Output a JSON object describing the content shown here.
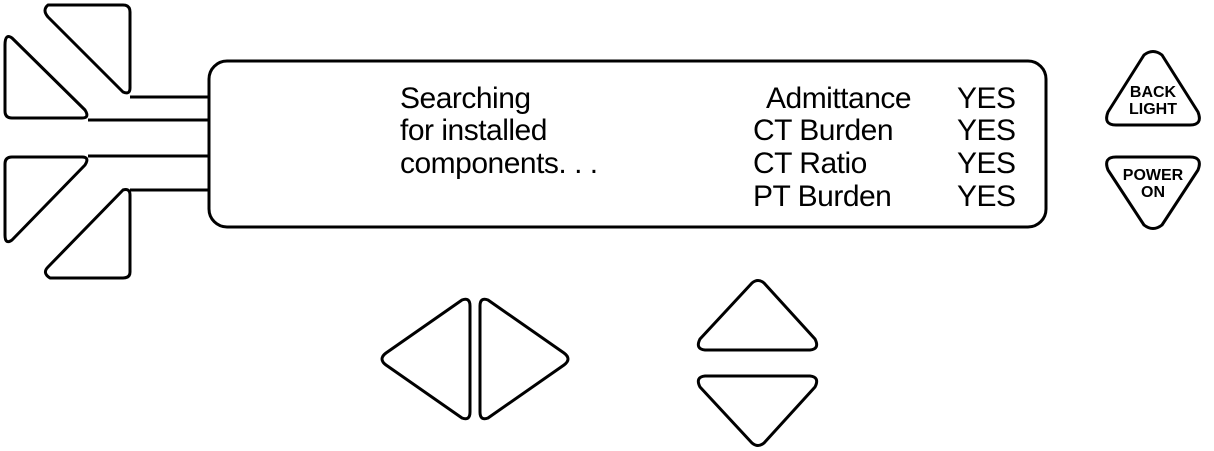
{
  "display": {
    "message_lines": [
      "Searching",
      "for installed",
      "components. . ."
    ],
    "components": [
      {
        "name": "Admittance",
        "status": "YES"
      },
      {
        "name": "CT Burden",
        "status": "YES"
      },
      {
        "name": "CT Ratio",
        "status": "YES"
      },
      {
        "name": "PT Burden",
        "status": "YES"
      }
    ]
  },
  "buttons": {
    "backlight": {
      "line1": "BACK",
      "line2": "LIGHT"
    },
    "power": {
      "line1": "POWER",
      "line2": "ON"
    }
  },
  "icons": {
    "soft_key_upper": "triangle-softkey-icon",
    "soft_key_lower": "triangle-softkey-icon",
    "left": "chevron-left-icon",
    "right": "chevron-right-icon",
    "up": "chevron-up-icon",
    "down": "chevron-down-icon"
  },
  "colors": {
    "line": "#000000",
    "background": "#ffffff"
  }
}
